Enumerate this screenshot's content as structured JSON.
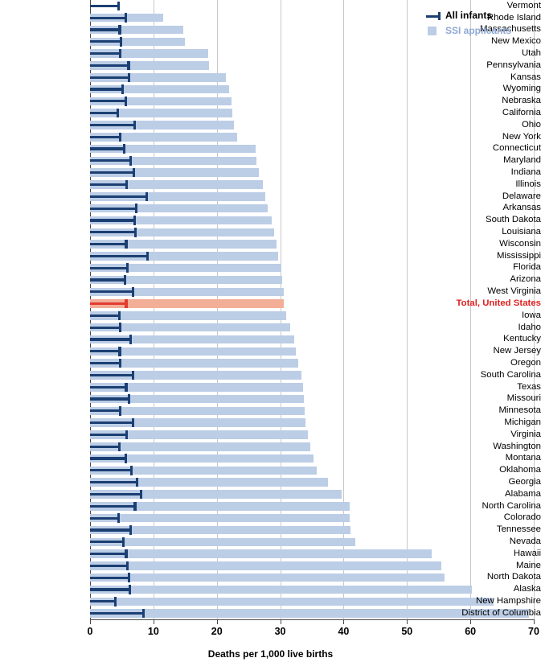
{
  "chart_data": {
    "type": "bar",
    "orientation": "horizontal",
    "title": "",
    "subtitle": "",
    "xlabel": "Deaths per 1,000 live births",
    "ylabel": "",
    "xlim": [
      0,
      70
    ],
    "xticks": [
      0,
      10,
      20,
      30,
      40,
      50,
      60,
      70
    ],
    "grid": "vertical",
    "legend_position": "top-right",
    "categories": [
      "Vermont",
      "Rhode Island",
      "Massachusetts",
      "New Mexico",
      "Utah",
      "Pennsylvania",
      "Kansas",
      "Wyoming",
      "Nebraska",
      "California",
      "Ohio",
      "New York",
      "Connecticut",
      "Maryland",
      "Indiana",
      "Illinois",
      "Delaware",
      "Arkansas",
      "South Dakota",
      "Louisiana",
      "Wisconsin",
      "Mississippi",
      "Florida",
      "Arizona",
      "West Virginia",
      "Total, United States",
      "Iowa",
      "Idaho",
      "Kentucky",
      "New Jersey",
      "Oregon",
      "South Carolina",
      "Texas",
      "Missouri",
      "Minnesota",
      "Michigan",
      "Virginia",
      "Washington",
      "Montana",
      "Oklahoma",
      "Georgia",
      "Alabama",
      "North Carolina",
      "Colorado",
      "Tennessee",
      "Nevada",
      "Hawaii",
      "Maine",
      "North Dakota",
      "Alaska",
      "New Hampshire",
      "District of Columbia"
    ],
    "series": [
      {
        "name": "SSI applicants",
        "color": "#bccde6",
        "values": [
          0.0,
          11.5,
          14.7,
          15.0,
          18.6,
          18.8,
          21.4,
          22.0,
          22.3,
          22.4,
          22.7,
          23.2,
          26.1,
          26.3,
          26.6,
          27.3,
          27.6,
          28.0,
          28.6,
          29.0,
          29.4,
          29.7,
          30.2,
          30.3,
          30.5,
          30.6,
          31.0,
          31.6,
          32.2,
          32.5,
          32.9,
          33.3,
          33.6,
          33.7,
          33.8,
          34.0,
          34.4,
          34.8,
          35.3,
          35.8,
          37.5,
          39.7,
          40.9,
          41.0,
          41.1,
          41.8,
          53.9,
          55.4,
          55.9,
          60.2,
          63.6,
          69.2
        ]
      },
      {
        "name": "All infants",
        "color": "#1b3f72",
        "values": [
          4.7,
          5.8,
          4.9,
          5.1,
          5.0,
          6.3,
          6.4,
          5.3,
          5.8,
          4.6,
          7.2,
          5.0,
          5.6,
          6.6,
          7.1,
          6.0,
          9.1,
          7.5,
          7.2,
          7.4,
          5.9,
          9.3,
          6.1,
          5.7,
          7.0,
          5.9,
          4.8,
          5.0,
          6.6,
          4.9,
          5.0,
          7.0,
          5.9,
          6.4,
          5.0,
          7.0,
          6.0,
          4.8,
          5.8,
          6.7,
          7.6,
          8.3,
          7.3,
          4.7,
          6.6,
          5.5,
          5.9,
          6.1,
          6.4,
          6.5,
          4.2,
          8.6
        ],
        "style": "line-with-endcap"
      }
    ],
    "highlight": {
      "category": "Total, United States",
      "bar_color": "#f3ae97",
      "line_color": "#e33b31",
      "label_color": "#e02020"
    }
  },
  "legend": {
    "items": [
      {
        "label": "All infants",
        "color": "#1b3f72",
        "marker": "line-endcap-icon"
      },
      {
        "label": "SSI applicants",
        "color": "#bccde6",
        "marker": "square-swatch-icon"
      }
    ]
  },
  "axis": {
    "title": "Deaths per 1,000 live births",
    "tick_labels": [
      "0",
      "10",
      "20",
      "30",
      "40",
      "50",
      "60",
      "70"
    ]
  }
}
